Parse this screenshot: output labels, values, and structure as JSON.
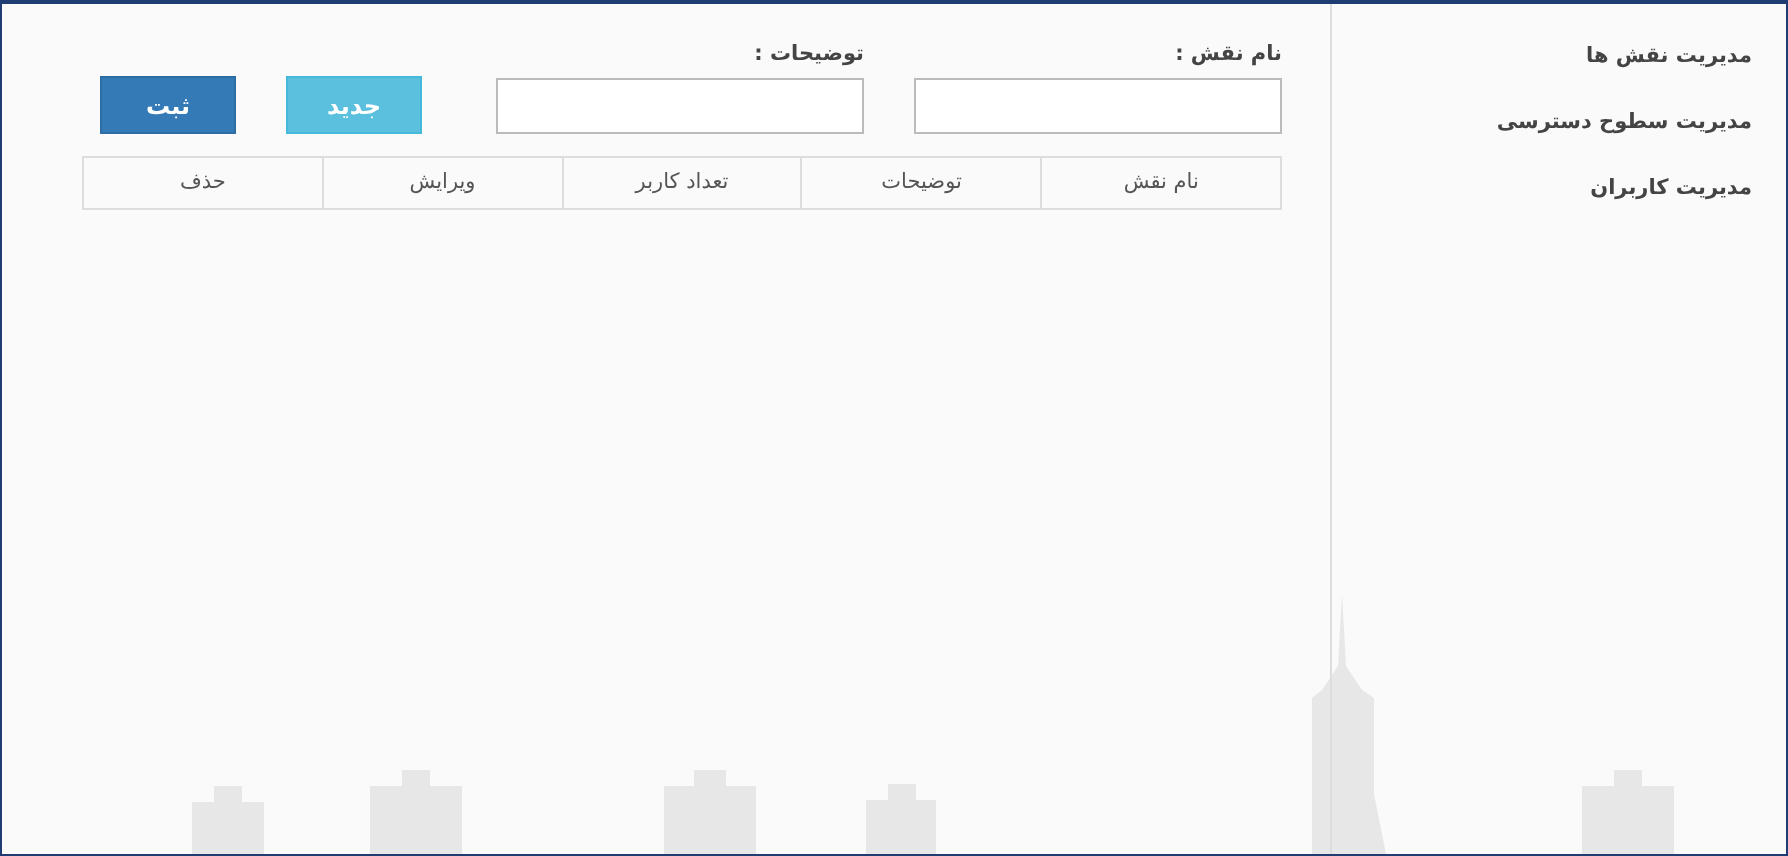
{
  "sidebar": {
    "items": [
      {
        "label": "مدیریت نقش ها"
      },
      {
        "label": "مدیریت سطوح دسترسی"
      },
      {
        "label": "مدیریت کاربران"
      }
    ]
  },
  "form": {
    "fields": [
      {
        "label": "نام نقش :"
      },
      {
        "label": "توضیحات :"
      }
    ],
    "buttons": [
      {
        "label": "جدید",
        "kind": "info"
      },
      {
        "label": "ثبت",
        "kind": "primary"
      }
    ]
  },
  "table": {
    "columns": [
      "نام نقش",
      "توضیحات",
      "تعداد کاربر",
      "ویرایش",
      "حذف"
    ]
  }
}
